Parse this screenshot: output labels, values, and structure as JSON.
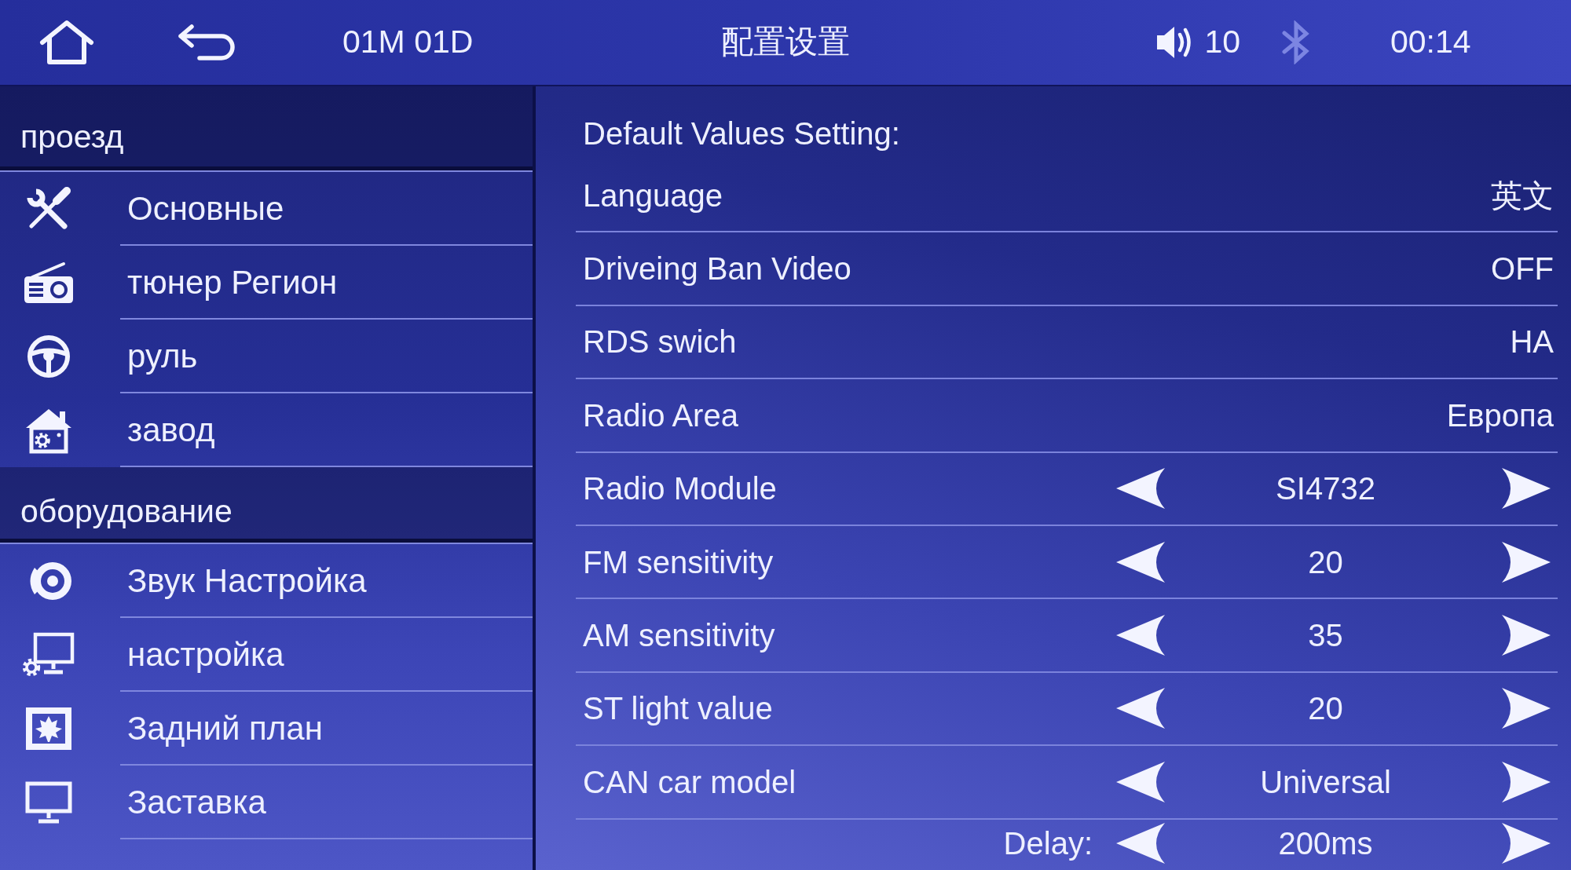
{
  "status_bar": {
    "date": "01M 01D",
    "title": "配置设置",
    "volume": "10",
    "bluetooth": {
      "on": false
    },
    "time": "00:14"
  },
  "sidebar": {
    "sections": [
      {
        "title": "проезд",
        "items": [
          {
            "label": "Основные"
          },
          {
            "label": "тюнер Регион"
          },
          {
            "label": "руль"
          },
          {
            "label": "завод"
          }
        ]
      },
      {
        "title": "оборудование",
        "items": [
          {
            "label": "Звук Настройка"
          },
          {
            "label": "настройка"
          },
          {
            "label": "Задний план"
          },
          {
            "label": "Заставка"
          }
        ]
      }
    ]
  },
  "settings": {
    "title": "Default Values Setting:",
    "rows": [
      {
        "kind": "value",
        "label": "Language",
        "value": "英文"
      },
      {
        "kind": "value",
        "label": "Driveing Ban Video",
        "value": "OFF"
      },
      {
        "kind": "value",
        "label": "RDS swich",
        "value": "HA"
      },
      {
        "kind": "value",
        "label": "Radio Area",
        "value": "Европа"
      },
      {
        "kind": "stepper",
        "label": "Radio Module",
        "value": "SI4732"
      },
      {
        "kind": "stepper",
        "label": "FM sensitivity",
        "value": "20"
      },
      {
        "kind": "stepper",
        "label": "AM sensitivity",
        "value": "35"
      },
      {
        "kind": "stepper",
        "label": "ST light value",
        "value": "20"
      },
      {
        "kind": "stepper",
        "label": "CAN car model",
        "value": "Universal"
      },
      {
        "kind": "inline_stepper",
        "label": "Delay:",
        "value": "200ms"
      }
    ]
  }
}
